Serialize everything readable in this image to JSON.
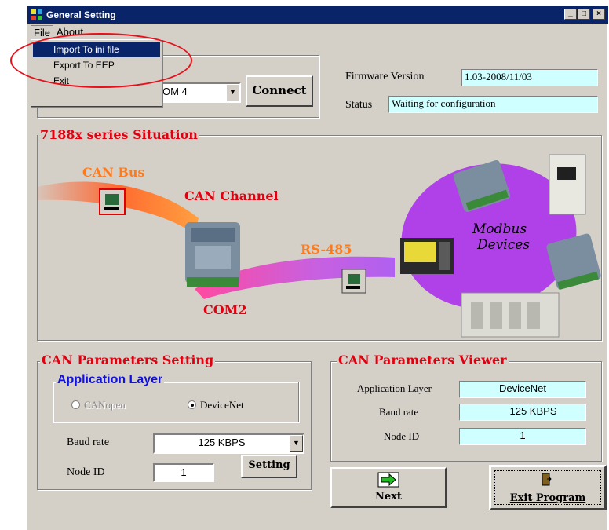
{
  "window": {
    "title": "General Setting",
    "min": "_",
    "max": "□",
    "close": "×"
  },
  "menu": {
    "file": "File",
    "about": "About",
    "file_items": [
      "Import To ini file",
      "Export To EEP",
      "Exit"
    ]
  },
  "connection": {
    "com_port_partial": "OM 4",
    "connect_label": "Connect",
    "firmware_label": "Firmware Version",
    "firmware_value": "1.03-2008/11/03",
    "status_label": "Status",
    "status_value": "Waiting for configuration"
  },
  "situation": {
    "title": "7188x series Situation",
    "can_bus": "CAN Bus",
    "can_channel": "CAN Channel",
    "rs485": "RS-485",
    "com2": "COM2",
    "modbus_line1": "Modbus",
    "modbus_line2": "Devices"
  },
  "can_setting": {
    "title": "CAN Parameters Setting",
    "app_layer_title": "Application Layer",
    "canopen": "CANopen",
    "devicenet": "DeviceNet",
    "baud_label": "Baud rate",
    "baud_value": "125   KBPS",
    "node_label": "Node ID",
    "node_value": "1",
    "setting_label": "Setting"
  },
  "can_viewer": {
    "title": "CAN Parameters Viewer",
    "app_layer_label": "Application Layer",
    "app_layer_value": "DeviceNet",
    "baud_label": "Baud rate",
    "baud_value": "125   KBPS",
    "node_label": "Node ID",
    "node_value": "1"
  },
  "buttons": {
    "next": "Next",
    "exit": "Exit Program"
  },
  "colors": {
    "title_bar": "#0a246a",
    "face": "#d4d0c8",
    "readonly_field": "#cfffff",
    "group_title": "#e0000f",
    "can_bus_text": "#ff7a1a",
    "app_layer_text": "#1010e0",
    "modbus_blob": "#b040e8"
  }
}
